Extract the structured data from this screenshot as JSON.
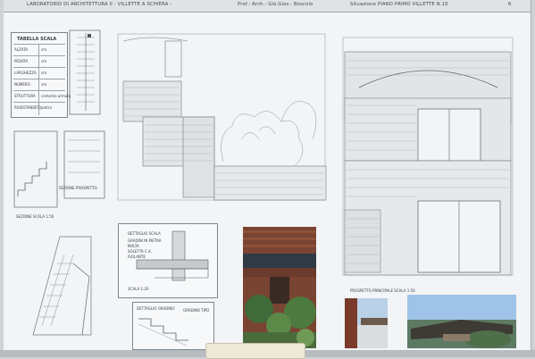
{
  "header": {
    "course": "LABORATORIO DI ARCHITETTURA II - VILLETTE A SCHIERA -",
    "students": "Prof.: Arch.: Gio.Giov.: Boscolo",
    "project": "Situazione PIANO PRIMO VILLETTE N.10"
  },
  "table": {
    "title": "TABELLA SCALA",
    "rows": [
      {
        "label": "ALZATA",
        "value": "cm"
      },
      {
        "label": "PEDATA",
        "value": "cm"
      },
      {
        "label": "LARGHEZZA",
        "value": "cm"
      },
      {
        "label": "NUMERO",
        "value": "cm"
      },
      {
        "label": "STRUTTURA",
        "value": "cemento armato"
      },
      {
        "label": "RIVESTIMENTO",
        "value": "pietra"
      }
    ]
  },
  "labels": {
    "section_a": "SEZIONE SCALA 1:50",
    "section_b": "SEZIONE PROSPETTO",
    "detail_a": "DETTAGLIO SCALA",
    "detail_b": "DETTAGLIO GRADINO",
    "elevation": "PROSPETTO PRINCIPALE SCALA 1:50",
    "detail_text_1": "GRADINI IN PIETRA",
    "detail_text_2": "MALTA",
    "detail_text_3": "SOLETTA C.A.",
    "detail_text_4": "ISOLANTE",
    "step_text": "GRADINO TIPO",
    "page_number": "6",
    "scale_note": "SCALA 1:20"
  },
  "colors": {
    "paper": "#f2f4f6",
    "line": "#6f7880",
    "brick": "#7a3b2b",
    "foliage": "#3f6a3a",
    "sky": "#9fc4e8"
  }
}
